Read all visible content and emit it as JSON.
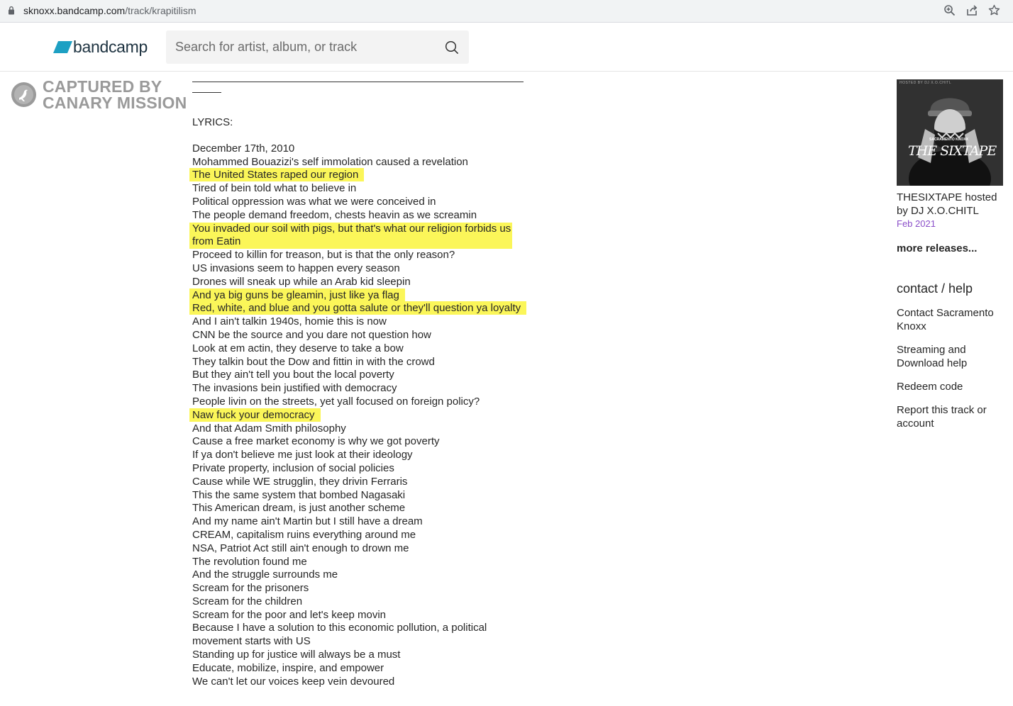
{
  "browser": {
    "url_host": "sknoxx.bandcamp.com",
    "url_path": "/track/krapitilism"
  },
  "header": {
    "logo_text": "bandcamp",
    "search_placeholder": "Search for artist, album, or track"
  },
  "watermark": {
    "line1": "CAPTURED BY",
    "line2": "CANARY MISSION"
  },
  "content": {
    "lyrics_label": "LYRICS:",
    "lines": [
      {
        "text": "December 17th, 2010"
      },
      {
        "text": "Mohammed Bouazizi's self immolation caused a revelation"
      },
      {
        "text": "The United States raped our region",
        "highlight": true
      },
      {
        "text": "Tired of bein told what to believe in"
      },
      {
        "text": "Political oppression was what we were conceived in"
      },
      {
        "text": "The people demand freedom, chests heavin as we screamin"
      },
      {
        "text": "You invaded our soil with pigs, but that's what our religion forbids us from Eatin",
        "highlight": true
      },
      {
        "text": "Proceed to killin for treason, but is that the only reason?"
      },
      {
        "text": "US invasions seem to happen every season"
      },
      {
        "text": "Drones will sneak up while an Arab kid sleepin"
      },
      {
        "text": "And ya big guns be gleamin, just like ya flag",
        "highlight": true
      },
      {
        "text": "Red, white, and blue and you gotta salute or they'll question ya loyalty",
        "highlight": true
      },
      {
        "text": "And I ain't talkin 1940s, homie this is now"
      },
      {
        "text": "CNN be the source and you dare not question how"
      },
      {
        "text": "Look at em actin, they deserve to take a bow"
      },
      {
        "text": "They talkin bout the Dow and fittin in with the crowd"
      },
      {
        "text": "But they ain't tell you bout the local poverty"
      },
      {
        "text": "The invasions bein justified with democracy"
      },
      {
        "text": "People livin on the streets, yet yall focused on foreign policy?"
      },
      {
        "text": "Naw fuck your democracy",
        "highlight": true
      },
      {
        "text": "And that Adam Smith philosophy"
      },
      {
        "text": "Cause a free market economy is why we got poverty"
      },
      {
        "text": "If ya don't believe me just look at their ideology"
      },
      {
        "text": "Private property, inclusion of social policies"
      },
      {
        "text": "Cause while WE strugglin, they drivin Ferraris"
      },
      {
        "text": "This the same system that bombed Nagasaki"
      },
      {
        "text": "This American dream, is just another scheme"
      },
      {
        "text": "And my name ain't Martin but I still have a dream"
      },
      {
        "text": "CREAM, capitalism ruins everything around me"
      },
      {
        "text": "NSA, Patriot Act still ain't enough to drown me"
      },
      {
        "text": "The revolution found me"
      },
      {
        "text": "And the struggle surrounds me"
      },
      {
        "text": "Scream for the prisoners"
      },
      {
        "text": "Scream for the children"
      },
      {
        "text": "Scream for the poor and let's keep movin"
      },
      {
        "text": "Because I have a solution to this economic pollution, a political movement starts with US"
      },
      {
        "text": "Standing up for justice will always be a must"
      },
      {
        "text": "Educate, mobilize, inspire, and empower"
      },
      {
        "text": "We can't let our voices keep vein devoured"
      }
    ],
    "highlight_color": "#fbf659"
  },
  "sidebar": {
    "cover_text": "THE SIXTAPE",
    "cover_small_text": "SACRAMENTO KNOXX",
    "cover_tag_text": "HOSTED BY DJ X.O.CHITL",
    "release_title": "THESIXTAPE hosted by DJ X.O.CHITL",
    "release_date": "Feb 2021",
    "more_releases": "more releases...",
    "help_heading": "contact / help",
    "links": [
      "Contact Sacramento Knoxx",
      "Streaming and Download help",
      "Redeem code",
      "Report this track or account"
    ]
  }
}
